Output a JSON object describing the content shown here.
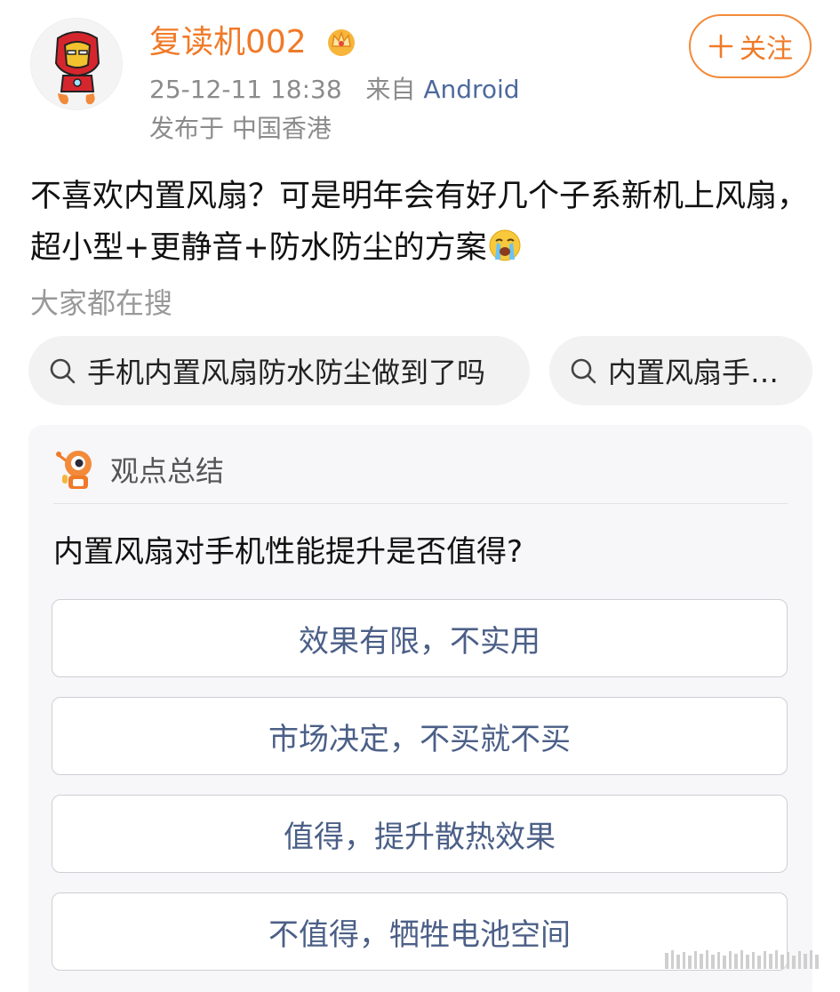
{
  "user": {
    "name": "复读机002",
    "timestamp": "25-12-11 18:38",
    "source_prefix": "来自",
    "source": "Android",
    "location": "发布于 中国香港"
  },
  "follow_button": {
    "icon": "plus-icon",
    "label": "关注"
  },
  "post": {
    "text": "不喜欢内置风扇？可是明年会有好几个子系新机上风扇，超小型+更静音+防水防尘的方案",
    "emoji": "crying-face"
  },
  "search": {
    "label": "大家都在搜",
    "chips": [
      {
        "icon": "search-icon",
        "text": "手机内置风扇防水防尘做到了吗"
      },
      {
        "icon": "search-icon",
        "text": "内置风扇手…"
      }
    ]
  },
  "summary_card": {
    "icon": "ai-robot-icon",
    "title": "观点总结",
    "question": "内置风扇对手机性能提升是否值得?",
    "options": [
      "效果有限，不实用",
      "市场决定，不买就不买",
      "值得，提升散热效果",
      "不值得，牺牲电池空间"
    ]
  },
  "colors": {
    "username": "#f07a28",
    "follow_border": "#f28a3a",
    "source_link": "#4d6a9c",
    "option_text": "#4b5f87",
    "card_bg": "#f7f7f9",
    "chip_bg": "#f2f2f2"
  }
}
